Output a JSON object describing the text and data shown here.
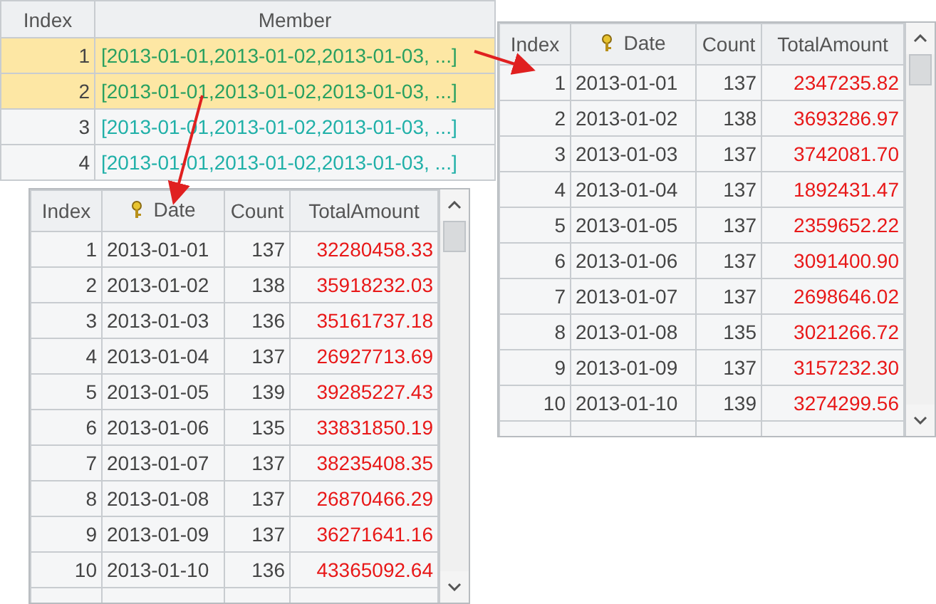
{
  "member_table": {
    "columns": [
      "Index",
      "Member"
    ],
    "rows": [
      {
        "index": "1",
        "member": "[2013-01-01,2013-01-02,2013-01-03, ...]",
        "selected": true
      },
      {
        "index": "2",
        "member": "[2013-01-01,2013-01-02,2013-01-03, ...]",
        "selected": true
      },
      {
        "index": "3",
        "member": "[2013-01-01,2013-01-02,2013-01-03, ...]",
        "selected": false
      },
      {
        "index": "4",
        "member": "[2013-01-01,2013-01-02,2013-01-03, ...]",
        "selected": false
      }
    ]
  },
  "detail_tables": [
    {
      "columns": [
        "Index",
        "Date",
        "Count",
        "TotalAmount"
      ],
      "rows": [
        {
          "index": "1",
          "date": "2013-01-01",
          "count": "137",
          "total": "2347235.82"
        },
        {
          "index": "2",
          "date": "2013-01-02",
          "count": "138",
          "total": "3693286.97"
        },
        {
          "index": "3",
          "date": "2013-01-03",
          "count": "137",
          "total": "3742081.70"
        },
        {
          "index": "4",
          "date": "2013-01-04",
          "count": "137",
          "total": "1892431.47"
        },
        {
          "index": "5",
          "date": "2013-01-05",
          "count": "137",
          "total": "2359652.22"
        },
        {
          "index": "6",
          "date": "2013-01-06",
          "count": "137",
          "total": "3091400.90"
        },
        {
          "index": "7",
          "date": "2013-01-07",
          "count": "137",
          "total": "2698646.02"
        },
        {
          "index": "8",
          "date": "2013-01-08",
          "count": "135",
          "total": "3021266.72"
        },
        {
          "index": "9",
          "date": "2013-01-09",
          "count": "137",
          "total": "3157232.30"
        },
        {
          "index": "10",
          "date": "2013-01-10",
          "count": "139",
          "total": "3274299.56"
        }
      ]
    },
    {
      "columns": [
        "Index",
        "Date",
        "Count",
        "TotalAmount"
      ],
      "rows": [
        {
          "index": "1",
          "date": "2013-01-01",
          "count": "137",
          "total": "32280458.33"
        },
        {
          "index": "2",
          "date": "2013-01-02",
          "count": "138",
          "total": "35918232.03"
        },
        {
          "index": "3",
          "date": "2013-01-03",
          "count": "136",
          "total": "35161737.18"
        },
        {
          "index": "4",
          "date": "2013-01-04",
          "count": "137",
          "total": "26927713.69"
        },
        {
          "index": "5",
          "date": "2013-01-05",
          "count": "139",
          "total": "39285227.43"
        },
        {
          "index": "6",
          "date": "2013-01-06",
          "count": "135",
          "total": "33831850.19"
        },
        {
          "index": "7",
          "date": "2013-01-07",
          "count": "137",
          "total": "38235408.35"
        },
        {
          "index": "8",
          "date": "2013-01-08",
          "count": "137",
          "total": "26870466.29"
        },
        {
          "index": "9",
          "date": "2013-01-09",
          "count": "137",
          "total": "36271641.16"
        },
        {
          "index": "10",
          "date": "2013-01-10",
          "count": "136",
          "total": "43365092.64"
        }
      ]
    }
  ]
}
